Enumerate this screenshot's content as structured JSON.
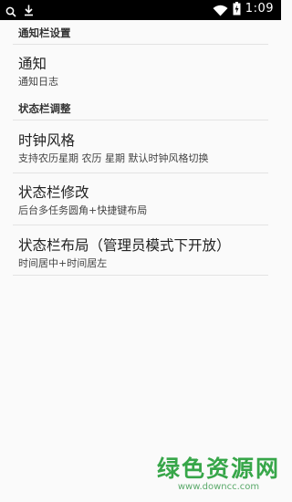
{
  "status_bar": {
    "time": "1:09",
    "icons": [
      "search-icon",
      "download-icon",
      "wifi-icon",
      "battery-icon"
    ]
  },
  "sections": [
    {
      "header": "通知栏设置",
      "items": [
        {
          "title": "通知",
          "summary": "通知日志"
        }
      ]
    },
    {
      "header": "状态栏调整",
      "items": [
        {
          "title": "时钟风格",
          "summary": "支持农历星期 农历 星期 默认时钟风格切换"
        },
        {
          "title": "状态栏修改",
          "summary": "后台多任务圆角+快捷键布局"
        },
        {
          "title": "状态栏布局（管理员模式下开放）",
          "summary": "时间居中+时间居左"
        }
      ]
    }
  ],
  "watermark": {
    "title": "绿色资源网",
    "url": "www.downcc.com"
  },
  "colors": {
    "status_bar_bg": "#000000",
    "background": "#fafafa",
    "watermark_green": "#37a649"
  }
}
